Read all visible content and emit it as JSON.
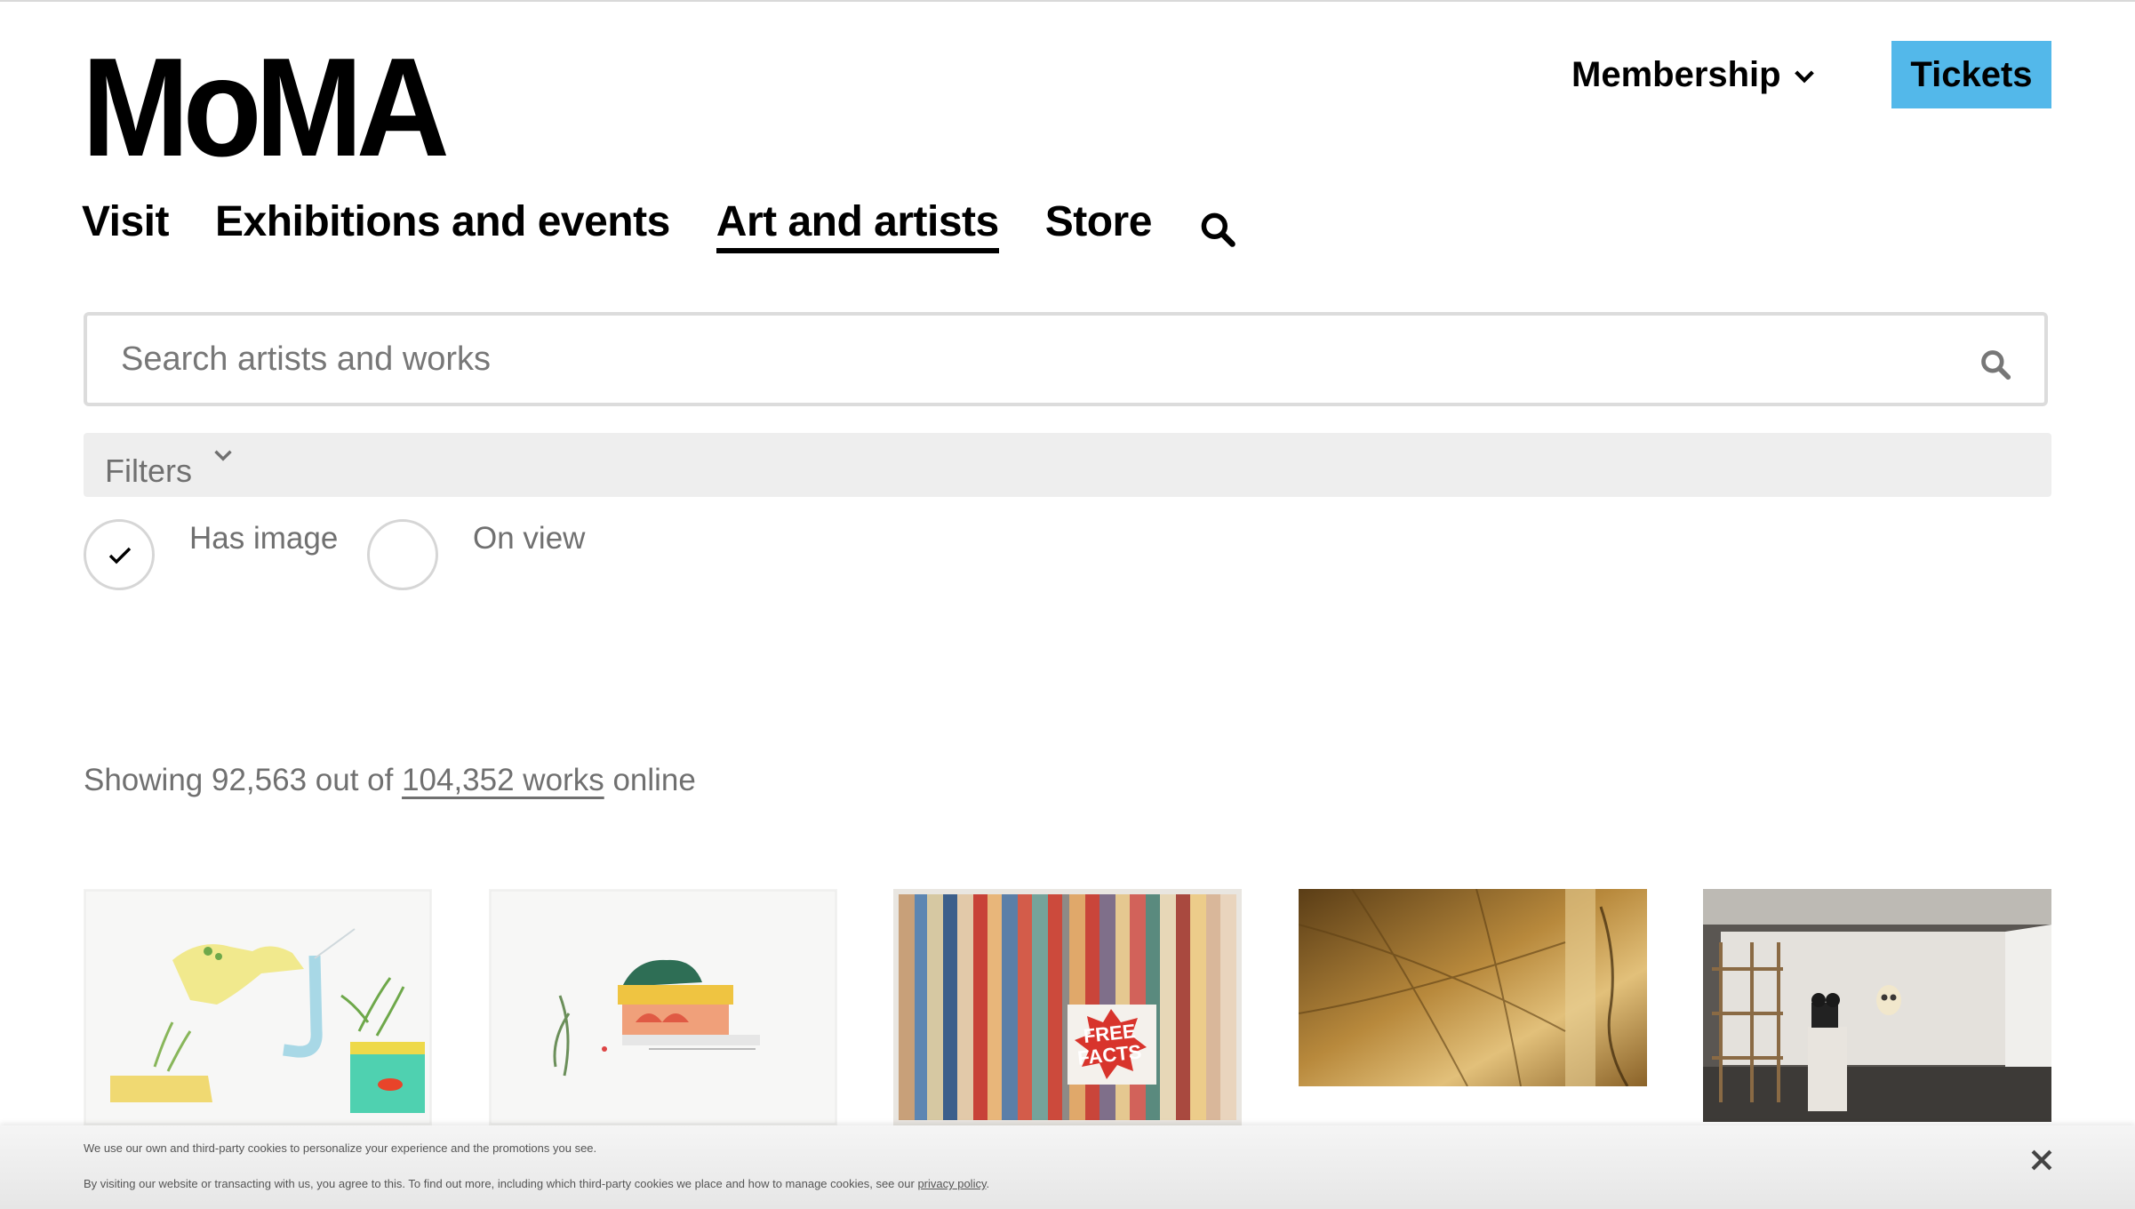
{
  "header": {
    "logo": "MoMA",
    "membership_label": "Membership",
    "tickets_label": "Tickets"
  },
  "nav": {
    "items": [
      {
        "label": "Visit"
      },
      {
        "label": "Exhibitions and events"
      },
      {
        "label": "Art and artists",
        "active": true
      },
      {
        "label": "Store"
      }
    ]
  },
  "search": {
    "placeholder": "Search artists and works"
  },
  "filters": {
    "label": "Filters",
    "options": [
      {
        "label": "Has image",
        "checked": true
      },
      {
        "label": "On view",
        "checked": false
      }
    ]
  },
  "results": {
    "prefix": "Showing 92,563 out of",
    "link": "104,352 works",
    "suffix": "online"
  },
  "thumbnails": [
    {
      "name": "artwork-drawing-plants-fish"
    },
    {
      "name": "artwork-drawing-colorful-structure"
    },
    {
      "name": "artwork-striped-book-free-facts",
      "text": [
        "FREE",
        "FACTS"
      ]
    },
    {
      "name": "artwork-leaf-closeup"
    },
    {
      "name": "artwork-installation-gallery"
    }
  ],
  "cookie": {
    "line1": "We use our own and third-party cookies to personalize your experience and the promotions you see.",
    "line2": "By visiting our website or transacting with us, you agree to this. To find out more, including which third-party cookies we place and how to manage cookies, see our",
    "link": "privacy policy",
    "end": "."
  },
  "colors": {
    "tickets_bg": "#53b8ea",
    "filters_bg": "#eeeeee",
    "stamp": "#d8342c"
  }
}
